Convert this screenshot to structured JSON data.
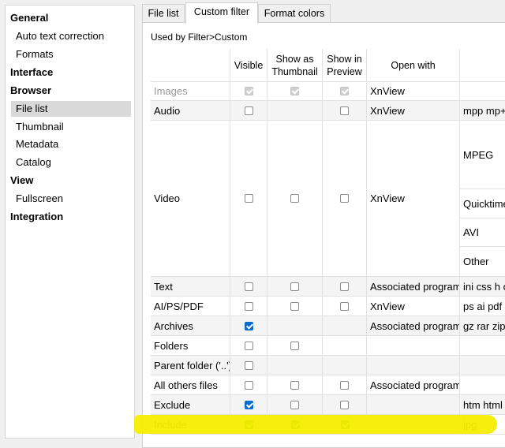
{
  "sidebar": {
    "items": [
      {
        "label": "General",
        "level": "top"
      },
      {
        "label": "Auto text correction",
        "level": "child"
      },
      {
        "label": "Formats",
        "level": "child"
      },
      {
        "label": "Interface",
        "level": "top"
      },
      {
        "label": "Browser",
        "level": "top"
      },
      {
        "label": "File list",
        "level": "child",
        "selected": true
      },
      {
        "label": "Thumbnail",
        "level": "child"
      },
      {
        "label": "Metadata",
        "level": "child"
      },
      {
        "label": "Catalog",
        "level": "child"
      },
      {
        "label": "View",
        "level": "top"
      },
      {
        "label": "Fullscreen",
        "level": "child"
      },
      {
        "label": "Integration",
        "level": "top"
      }
    ]
  },
  "tabs": [
    {
      "label": "File list",
      "active": false
    },
    {
      "label": "Custom filter",
      "active": true
    },
    {
      "label": "Format colors",
      "active": false
    }
  ],
  "panel": {
    "title": "Used by Filter>Custom",
    "headers": {
      "visible": "Visible",
      "thumb": "Show as Thumbnail",
      "preview": "Show in Preview",
      "openwith": "Open with"
    },
    "rows": [
      {
        "label": "Images",
        "dim": true,
        "visible": "dis-on",
        "thumb": "dis-on",
        "preview": "dis-on",
        "openwith": "XnView",
        "ext": ""
      },
      {
        "label": "Audio",
        "visible": "off",
        "thumb": "none",
        "preview": "off",
        "openwith": "XnView",
        "ext": "mpp mp+"
      },
      {
        "label": "Video",
        "visible": "off",
        "thumb": "off",
        "preview": "off",
        "openwith": "XnView",
        "ext": "",
        "subs": [
          "MPEG",
          "Quicktime",
          "AVI",
          "Other"
        ]
      },
      {
        "label": "Text",
        "visible": "off",
        "thumb": "off",
        "preview": "off",
        "openwith": "Associated program",
        "ext": "ini css h c"
      },
      {
        "label": "AI/PS/PDF",
        "visible": "off",
        "thumb": "off",
        "preview": "off",
        "openwith": "XnView",
        "ext": "ps ai pdf e"
      },
      {
        "label": "Archives",
        "visible": "on",
        "thumb": "none",
        "preview": "none",
        "openwith": "Associated program",
        "ext": "gz rar zip"
      },
      {
        "label": "Folders",
        "visible": "off",
        "thumb": "off",
        "preview": "none",
        "openwith": "",
        "ext": ""
      },
      {
        "label": "Parent folder ('..')",
        "visible": "off",
        "thumb": "none",
        "preview": "none",
        "openwith": "",
        "ext": ""
      },
      {
        "label": "All others files",
        "visible": "off",
        "thumb": "off",
        "preview": "off",
        "openwith": "Associated program",
        "ext": ""
      },
      {
        "label": "Exclude",
        "visible": "on",
        "thumb": "off",
        "preview": "off",
        "openwith": "",
        "ext": "htm html"
      },
      {
        "label": "Include",
        "visible": "green",
        "thumb": "green",
        "preview": "green",
        "openwith": "",
        "ext": "jpg",
        "highlighted": true
      }
    ]
  },
  "colors": {
    "highlight": "#f5ee00",
    "checked": "#0a6cc8",
    "selected_bg": "#d9d9d9"
  }
}
